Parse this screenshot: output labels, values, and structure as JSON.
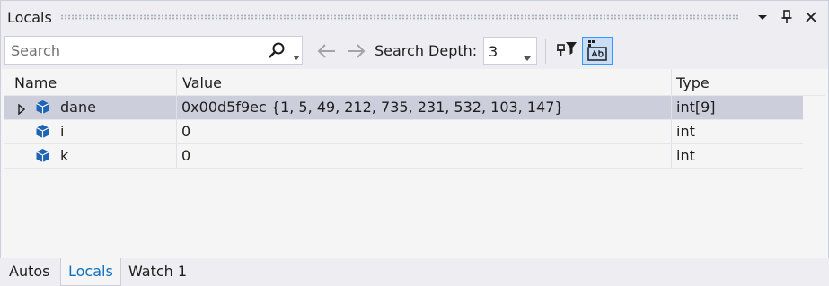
{
  "panel": {
    "title": "Locals"
  },
  "toolbar": {
    "search_placeholder": "Search",
    "search_depth_label": "Search Depth:",
    "search_depth_value": "3"
  },
  "grid": {
    "columns": [
      "Name",
      "Value",
      "Type"
    ],
    "rows": [
      {
        "name": "dane",
        "value": "0x00d5f9ec {1, 5, 49, 212, 735, 231, 532, 103, 147}",
        "type": "int[9]",
        "expandable": true,
        "selected": true
      },
      {
        "name": "i",
        "value": "0",
        "type": "int",
        "expandable": false,
        "selected": false
      },
      {
        "name": "k",
        "value": "0",
        "type": "int",
        "expandable": false,
        "selected": false
      }
    ]
  },
  "tabs": [
    {
      "label": "Autos",
      "active": false
    },
    {
      "label": "Locals",
      "active": true
    },
    {
      "label": "Watch 1",
      "active": false
    }
  ],
  "colors": {
    "accent": "#0e70c0",
    "selection": "#cccedb",
    "icon_blue": "#1e64b4",
    "toggle_bg": "#c9def5"
  }
}
